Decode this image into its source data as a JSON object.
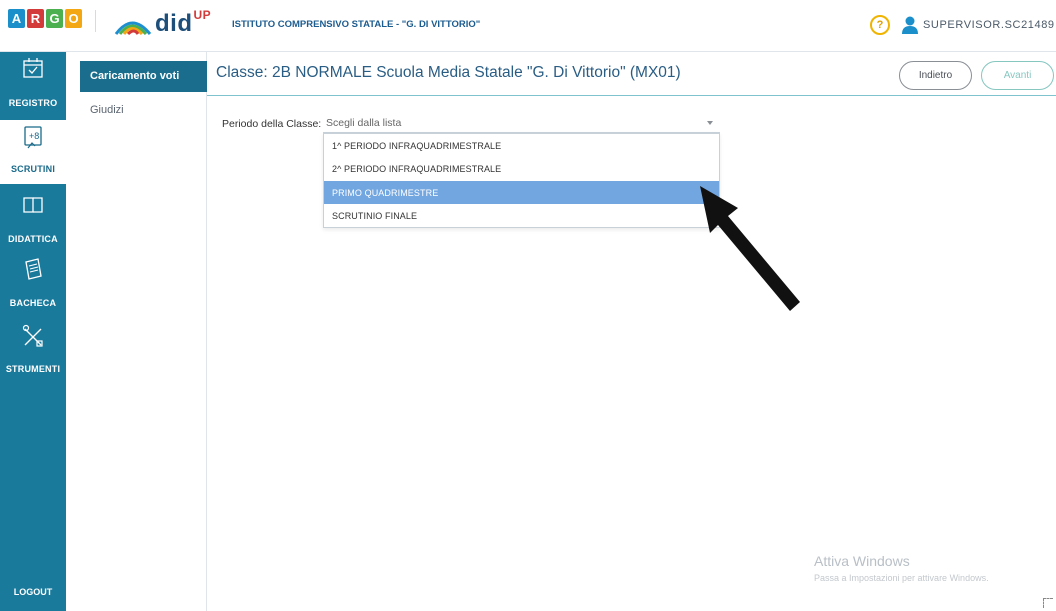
{
  "topbar": {
    "argo_letters": [
      "A",
      "R",
      "G",
      "O"
    ],
    "app_name": "did",
    "app_superscript": "UP",
    "school_name": "ISTITUTO COMPRENSIVO STATALE - \"G. DI VITTORIO\"",
    "help_symbol": "?",
    "username": "SUPERVISOR.SC21489"
  },
  "sidebar": {
    "items": [
      {
        "label": "REGISTRO",
        "icon": "calendar-check-icon"
      },
      {
        "label": "SCRUTINI",
        "icon": "grade-plus-icon"
      },
      {
        "label": "DIDATTICA",
        "icon": "book-icon"
      },
      {
        "label": "BACHECA",
        "icon": "notepad-icon"
      },
      {
        "label": "STRUMENTI",
        "icon": "tools-icon"
      }
    ],
    "logout": "LOGOUT"
  },
  "submenu": {
    "active": "Caricamento voti",
    "item": "Giudizi"
  },
  "main": {
    "title": "Classe: 2B NORMALE Scuola Media Statale \"G. Di Vittorio\" (MX01)",
    "back_button": "Indietro",
    "next_button": "Avanti"
  },
  "form": {
    "period_label": "Periodo della Classe:",
    "select_value": "Scegli dalla lista",
    "options": [
      "1^ PERIODO INFRAQUADRIMESTRALE",
      "2^ PERIODO INFRAQUADRIMESTRALE",
      "PRIMO QUADRIMESTRE",
      "SCRUTINIO FINALE"
    ],
    "highlighted_option": "PRIMO QUADRIMESTRE"
  },
  "watermark": {
    "title": "Attiva Windows",
    "subtitle": "Passa a Impostazioni per attivare Windows."
  },
  "colors": {
    "sidebar": "#1a7a9c",
    "submenu_active": "#1a6d8c",
    "highlight": "#72a6e0",
    "title": "#2a5d84"
  }
}
